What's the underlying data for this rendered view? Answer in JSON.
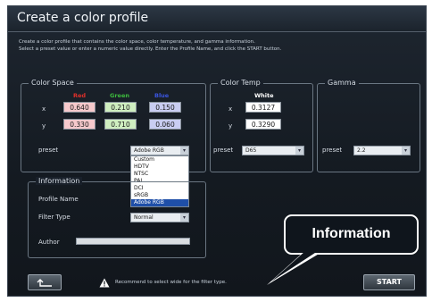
{
  "window": {
    "title": "Create a color profile",
    "description_line1": "Create a color profile that contains the color space, color temperature, and gamma information.",
    "description_line2": "Select a preset value or enter a numeric value directly. Enter the Profile Name, and click the START button."
  },
  "color_space": {
    "title": "Color Space",
    "headers": {
      "red": "Red",
      "green": "Green",
      "blue": "Blue"
    },
    "row_x_label": "x",
    "row_y_label": "y",
    "x_values": {
      "red": "0.640",
      "green": "0.210",
      "blue": "0.150"
    },
    "y_values": {
      "red": "0.330",
      "green": "0.710",
      "blue": "0.060"
    },
    "preset_label": "preset",
    "preset_value": "Adobe RGB",
    "preset_options": [
      "Custom",
      "HDTV",
      "NTSC",
      "PAL",
      "DCI",
      "sRGB",
      "Adobe RGB"
    ],
    "selected_option": "Adobe RGB"
  },
  "color_temp": {
    "title": "Color Temp",
    "header": "White",
    "row_x_label": "x",
    "row_y_label": "y",
    "x_value": "0.3127",
    "y_value": "0.3290",
    "preset_label": "preset",
    "preset_value": "D65"
  },
  "gamma": {
    "title": "Gamma",
    "preset_label": "preset",
    "preset_value": "2.2"
  },
  "information": {
    "title": "Information",
    "profile_name_label": "Profile Name",
    "filter_type_label": "Filter Type",
    "filter_type_value": "Normal",
    "author_label": "Author"
  },
  "footer": {
    "warning": "Recommend to select wide for the filter type.",
    "start_label": "START"
  },
  "callout": {
    "label": "Information"
  },
  "colors": {
    "red_header": "#e0302a",
    "green_header": "#3dbb3d",
    "blue_header": "#3a55e0",
    "red_cell": "#f6c9cc",
    "green_cell": "#cfeec0",
    "blue_cell": "#c9cdf2",
    "selection": "#1f4fa8"
  }
}
